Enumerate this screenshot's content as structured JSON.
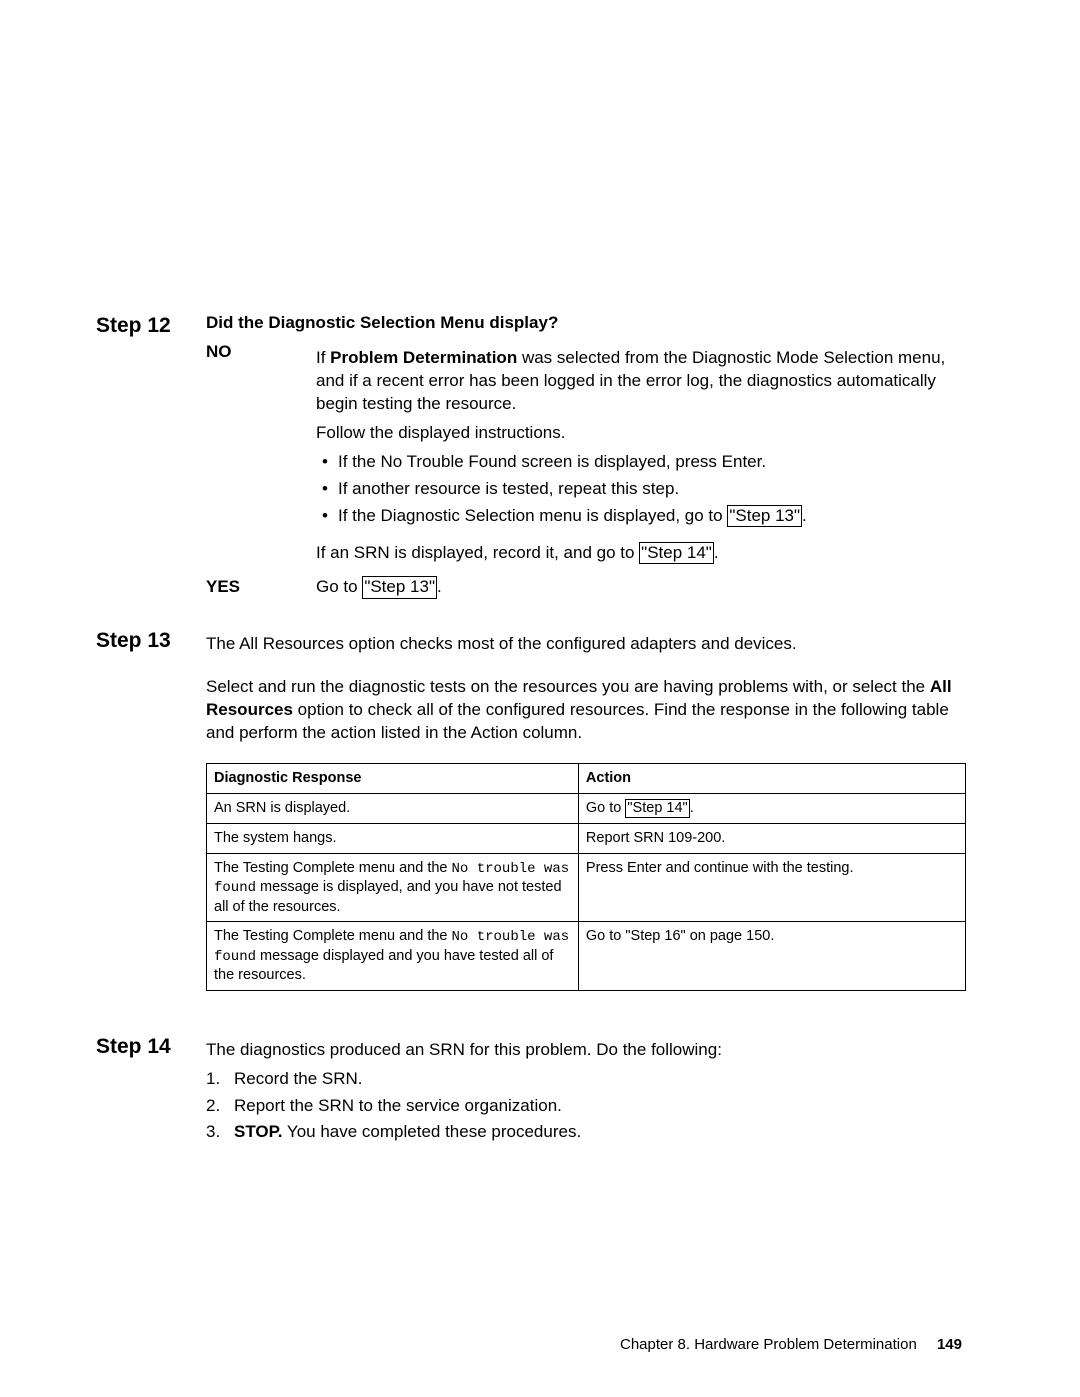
{
  "step12": {
    "heading": "Step 12",
    "question": "Did the Diagnostic Selection Menu display?",
    "no": {
      "label": "NO",
      "p1_a": "If ",
      "p1_bold": "Problem Determination",
      "p1_b": " was selected from the Diagnostic Mode Selection menu, and if a recent error has been logged in the error log, the diagnostics automatically begin testing the resource.",
      "p2": "Follow the displayed instructions.",
      "bullets": [
        "If the No Trouble Found screen is displayed, press Enter.",
        "If another resource is tested, repeat this step."
      ],
      "bullet3_a": "If the Diagnostic Selection menu is displayed, go to ",
      "bullet3_link": "\"Step 13\"",
      "bullet3_b": ".",
      "p3_a": "If an SRN is displayed, record it, and go to ",
      "p3_link": "\"Step 14\"",
      "p3_b": "."
    },
    "yes": {
      "label": "YES",
      "p_a": "Go to ",
      "p_link": "\"Step 13\"",
      "p_b": "."
    }
  },
  "step13": {
    "heading": "Step 13",
    "p1": "The All Resources option checks most of the configured adapters and devices.",
    "p2_a": "Select and run the diagnostic tests on the resources you are having problems with, or select the ",
    "p2_bold": "All Resources",
    "p2_b": " option to check all of the configured resources. Find the response in the following table and perform the action listed in the Action column.",
    "table": {
      "h1": "Diagnostic Response",
      "h2": "Action",
      "r1c1": "An SRN is displayed.",
      "r1c2a": "Go to ",
      "r1c2link": "\"Step 14\"",
      "r1c2b": ".",
      "r2c1": "The system hangs.",
      "r2c2": "Report SRN 109-200.",
      "r3c1a": "The Testing Complete menu and the ",
      "r3c1mono": "No trouble was found",
      "r3c1b": " message is displayed, and you have not tested all of the resources.",
      "r3c2": "Press Enter and continue with the testing.",
      "r4c1a": "The Testing Complete menu and the ",
      "r4c1mono": "No trouble was found",
      "r4c1b": " message displayed and you have tested all of the resources.",
      "r4c2": "Go to \"Step 16\" on page 150."
    }
  },
  "step14": {
    "heading": "Step 14",
    "p1": "The diagnostics produced an SRN for this problem. Do the following:",
    "li1": "Record the SRN.",
    "li2": "Report the SRN to the service organization.",
    "li3_bold": "STOP.",
    "li3_rest": " You have completed these procedures."
  },
  "footer": {
    "chapter": "Chapter 8. Hardware Problem Determination",
    "page": "149"
  }
}
